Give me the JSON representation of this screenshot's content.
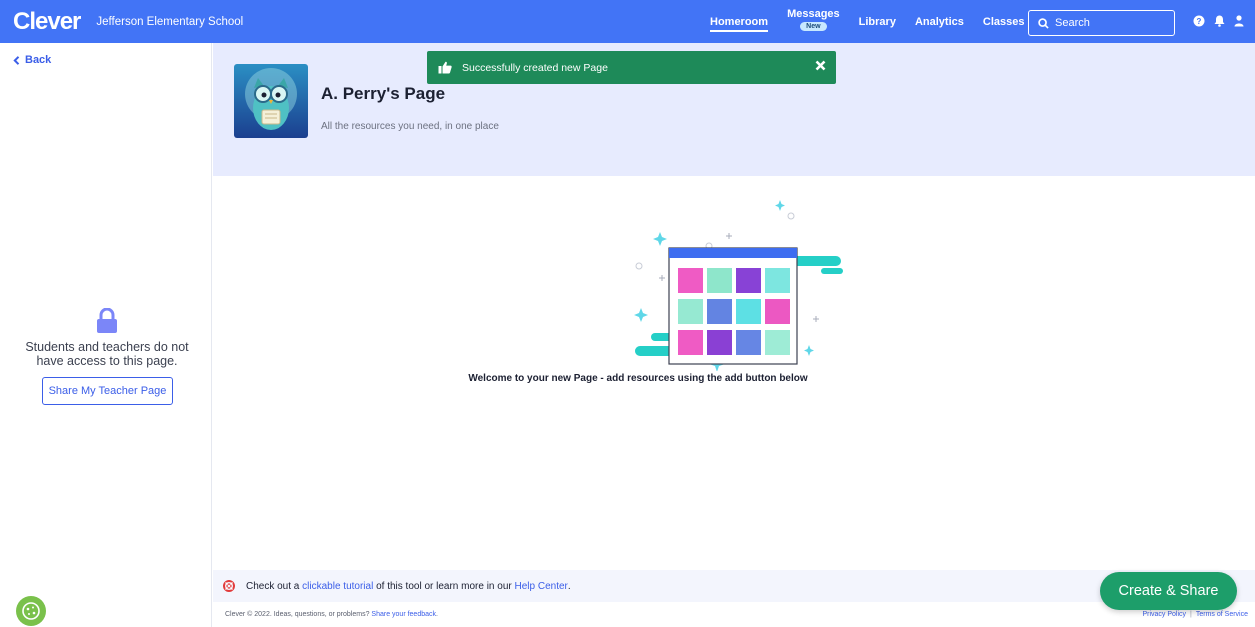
{
  "nav": {
    "logo": "Clever",
    "district": "Jefferson Elementary School",
    "links": {
      "homeroom": "Homeroom",
      "messages": "Messages",
      "messages_badge": "New",
      "library": "Library",
      "analytics": "Analytics",
      "classes": "Classes"
    },
    "search_placeholder": "Search",
    "icons": [
      "help-icon",
      "bell-icon",
      "user-icon"
    ]
  },
  "sidebar": {
    "back_label": "Back",
    "no_access_text": "Students and teachers do not have access to this page.",
    "share_button": "Share My Teacher Page"
  },
  "header": {
    "title": "A. Perry's Page",
    "subtitle": "All the resources you need, in one place"
  },
  "toast": {
    "message": "Successfully created new Page"
  },
  "main": {
    "welcome": "Welcome to your new Page - add resources using the add button below"
  },
  "helpbar": {
    "prefix": "Check out a ",
    "tutorial_link": "clickable tutorial",
    "middle": " of this tool or learn more in our ",
    "help_link": "Help Center",
    "suffix": "."
  },
  "footer": {
    "copyright": "Clever © 2022. Ideas, questions, or problems? ",
    "feedback_link": "Share your feedback",
    "feedback_suffix": ".",
    "privacy": "Privacy Policy",
    "terms": "Terms of Service"
  },
  "create_button": "Create & Share",
  "colors": {
    "nav_blue": "#4274f6",
    "toast_green": "#1e8a59",
    "create_green": "#1d9e6a",
    "header_bg": "#e7ebfe"
  }
}
